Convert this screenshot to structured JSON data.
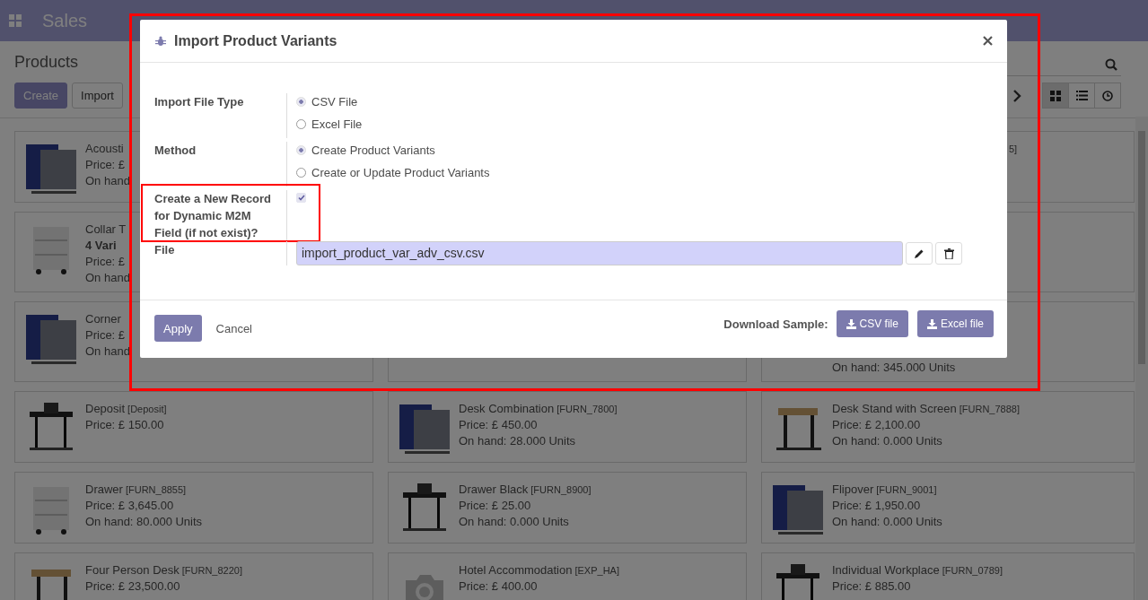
{
  "topbar": {
    "app": "Sales"
  },
  "control_panel": {
    "title": "Products",
    "buttons": [
      "Create",
      "Import"
    ],
    "views": [
      {
        "kind": "kanban",
        "selected": true
      },
      {
        "kind": "list",
        "selected": false
      },
      {
        "kind": "activity",
        "selected": false
      }
    ]
  },
  "products": [
    {
      "kind": "picture",
      "name": "Acousti",
      "price": "Price: £",
      "on_hand": "On hand"
    },
    {
      "kind": "blank",
      "code": "5]"
    },
    {
      "kind": "picture",
      "name": "Collar T",
      "variants": "4 Vari",
      "price": "Price: £",
      "on_hand": "On hand"
    },
    {
      "kind": "blank"
    },
    {
      "kind": "picture",
      "name": "Corner",
      "price": "Price: £",
      "on_hand": "On hand"
    },
    {
      "kind": "blank"
    },
    {
      "kind": "blank",
      "on_hand": "On hand: 345.000 Units"
    },
    {
      "kind": "picture",
      "name": "Deposit",
      "code": "[Deposit]",
      "price": "Price: £ 150.00"
    },
    {
      "kind": "picture",
      "name": "Desk Combination",
      "code": "[FURN_7800]",
      "price": "Price: £ 450.00",
      "on_hand": "On hand: 28.000 Units"
    },
    {
      "kind": "picture",
      "name": "Desk Stand with Screen",
      "code": "[FURN_7888]",
      "price": "Price: £ 2,100.00",
      "on_hand": "On hand: 0.000 Units"
    },
    {
      "kind": "picture",
      "name": "Drawer",
      "code": "[FURN_8855]",
      "price": "Price: £ 3,645.00",
      "on_hand": "On hand: 80.000 Units"
    },
    {
      "kind": "picture",
      "name": "Drawer Black",
      "code": "[FURN_8900]",
      "price": "Price: £ 25.00",
      "on_hand": "On hand: 0.000 Units"
    },
    {
      "kind": "picture",
      "name": "Flipover",
      "code": "[FURN_9001]",
      "price": "Price: £ 1,950.00",
      "on_hand": "On hand: 0.000 Units"
    },
    {
      "kind": "picture",
      "name": "Four Person Desk",
      "code": "[FURN_8220]",
      "price": "Price: £ 23,500.00"
    },
    {
      "kind": "placeholder",
      "name": "Hotel Accommodation",
      "code": "[EXP_HA]",
      "price": "Price: £ 400.00"
    },
    {
      "kind": "picture",
      "name": "Individual Workplace",
      "code": "[FURN_0789]",
      "price": "Price: £ 885.00"
    }
  ],
  "dialog": {
    "title": "Import Product Variants",
    "fields": [
      {
        "kind": "radio",
        "label": "Import File Type",
        "options": [
          {
            "label": "CSV File",
            "selected": true
          },
          {
            "label": "Excel File",
            "selected": false
          }
        ]
      },
      {
        "kind": "radio",
        "label": "Method",
        "options": [
          {
            "label": "Create Product Variants",
            "selected": true
          },
          {
            "label": "Create or Update Product Variants",
            "selected": false
          }
        ]
      },
      {
        "kind": "checkbox",
        "label": "Create a New Record for Dynamic M2M Field (if not exist)?",
        "checked": true,
        "highlighted": true
      },
      {
        "kind": "file",
        "label": "File",
        "value": "import_product_var_adv_csv.csv"
      }
    ],
    "apply": "Apply",
    "cancel": "Cancel",
    "sample_label": "Download Sample:",
    "samples": [
      "CSV file",
      "Excel file"
    ]
  }
}
